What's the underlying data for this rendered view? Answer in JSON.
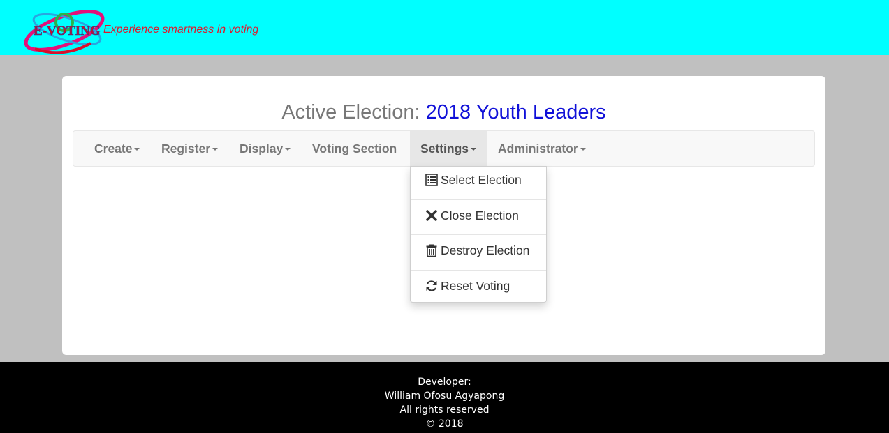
{
  "header": {
    "logo_text": "E-VOTING",
    "tagline": "Experience smartness in voting",
    "background_color": "#00ffff"
  },
  "election": {
    "label": "Active Election:",
    "name": "2018 Youth Leaders"
  },
  "nav": {
    "items": [
      {
        "label": "Create",
        "has_caret": true
      },
      {
        "label": "Register",
        "has_caret": true
      },
      {
        "label": "Display",
        "has_caret": true
      },
      {
        "label": "Voting Section",
        "has_caret": false
      },
      {
        "label": "Settings",
        "has_caret": true,
        "open": true
      },
      {
        "label": "Administrator",
        "has_caret": true
      }
    ]
  },
  "settings_menu": {
    "items": [
      {
        "label": "Select Election",
        "icon": "list-alt-icon"
      },
      {
        "label": "Close Election",
        "icon": "close-icon"
      },
      {
        "label": "Destroy Election",
        "icon": "trash-icon"
      },
      {
        "label": "Reset Voting",
        "icon": "refresh-icon"
      }
    ]
  },
  "footer": {
    "developer_label": "Developer:",
    "developer_name": "William Ofosu Agyapong",
    "rights": "All rights reserved",
    "copyright": "© 2018"
  },
  "colors": {
    "page_background": "#c0c0c0",
    "election_name": "#1010d8",
    "footer_background": "#000000"
  }
}
